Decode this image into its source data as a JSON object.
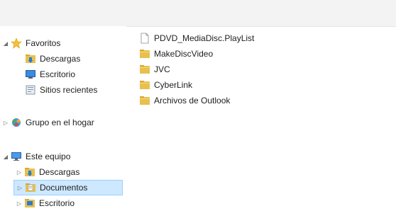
{
  "nav": {
    "items": [
      {
        "label": "Favoritos",
        "icon": "star-icon",
        "group": true
      },
      {
        "label": "Descargas",
        "icon": "downloads-folder-icon"
      },
      {
        "label": "Escritorio",
        "icon": "desktop-icon"
      },
      {
        "label": "Sitios recientes",
        "icon": "recent-places-icon"
      },
      {
        "label": "Grupo en el hogar",
        "icon": "homegroup-icon",
        "group": true
      },
      {
        "label": "Este equipo",
        "icon": "computer-icon",
        "group": true
      },
      {
        "label": "Descargas",
        "icon": "downloads-folder-icon"
      },
      {
        "label": "Documentos",
        "icon": "documents-folder-icon",
        "selected": true
      },
      {
        "label": "Escritorio",
        "icon": "desktop-folder-icon"
      }
    ]
  },
  "files": [
    {
      "name": "PDVD_MediaDisc.PlayList",
      "icon": "file-icon"
    },
    {
      "name": "MakeDiscVideo",
      "icon": "folder-icon"
    },
    {
      "name": "JVC",
      "icon": "folder-icon"
    },
    {
      "name": "CyberLink",
      "icon": "folder-icon"
    },
    {
      "name": "Archivos de Outlook",
      "icon": "folder-icon"
    }
  ],
  "colors": {
    "selection_bg": "#cde8ff",
    "selection_border": "#99d1ff",
    "folder": "#e8c050"
  }
}
